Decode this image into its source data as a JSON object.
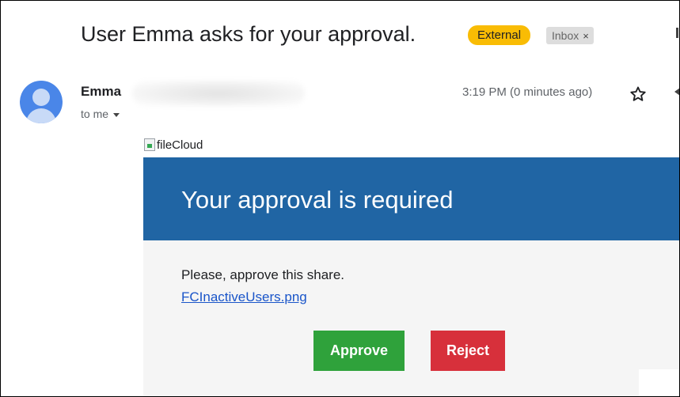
{
  "email": {
    "subject": "User Emma asks for your approval.",
    "labels": {
      "external": "External",
      "inbox": "Inbox",
      "inbox_remove_glyph": "×"
    },
    "sender": {
      "name": "Emma",
      "recipient_text": "to me",
      "timestamp": "3:19 PM (0 minutes ago)"
    },
    "icons": {
      "avatar": "person-avatar",
      "star": "star-outline-icon",
      "reply": "reply-icon",
      "recipients_toggle": "chevron-down-icon",
      "broken_image": "broken-image-icon"
    }
  },
  "body": {
    "logo_alt": "fileCloud",
    "banner_title": "Your approval is required",
    "message": "Please, approve this share.",
    "file_link": "FCInactiveUsers.png",
    "approve_label": "Approve",
    "reject_label": "Reject"
  },
  "colors": {
    "external_label_bg": "#f9bc04",
    "banner_bg": "#2065a4",
    "approve_bg": "#2fa23b",
    "reject_bg": "#d7303b",
    "link": "#1a55c9"
  }
}
